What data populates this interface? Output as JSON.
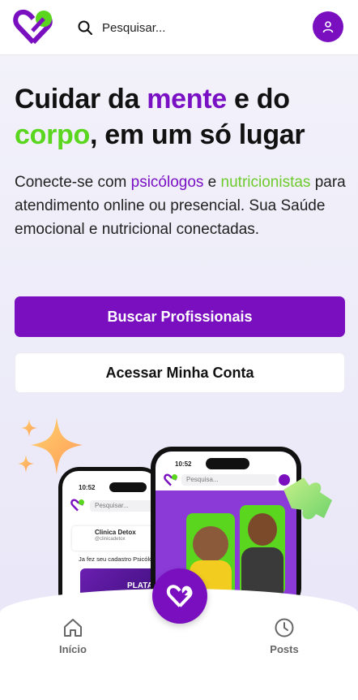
{
  "header": {
    "search_placeholder": "Pesquisar...",
    "icons": {
      "logo": "heart-logo-icon",
      "search": "search-icon",
      "profile": "user-icon"
    }
  },
  "hero": {
    "headline_part1": "Cuidar da ",
    "headline_highlight1": "mente",
    "headline_part2": " e do ",
    "headline_highlight2": "corpo",
    "headline_part3": ", em um só lugar",
    "sub_part1": "Conecte-se com ",
    "sub_highlight1": "psicólogos",
    "sub_part2": " e ",
    "sub_highlight2": "nutricionistas",
    "sub_part3": " para atendimento online ou presencial. Sua Saúde emocional e nutricional conectadas.",
    "primary_button": "Buscar Profissionais",
    "secondary_button": "Acessar Minha Conta"
  },
  "illustration": {
    "phone_left": {
      "time": "10:52",
      "search_placeholder": "Pesquisar...",
      "card_title": "Clinica Detox",
      "card_handle": "@clinicadetox",
      "card_text": "Ja fez seu cadastro Psicólo",
      "banner_text": "PLATA"
    },
    "phone_right": {
      "time": "10:52",
      "search_placeholder": "Pesquisa..."
    }
  },
  "bottom_nav": {
    "home_label": "Início",
    "posts_label": "Posts",
    "icons": {
      "home": "home-icon",
      "center": "heart-logo-icon",
      "posts": "clock-icon"
    }
  },
  "colors": {
    "brand_purple": "#7a0fc0",
    "brand_green": "#5ad61e"
  }
}
